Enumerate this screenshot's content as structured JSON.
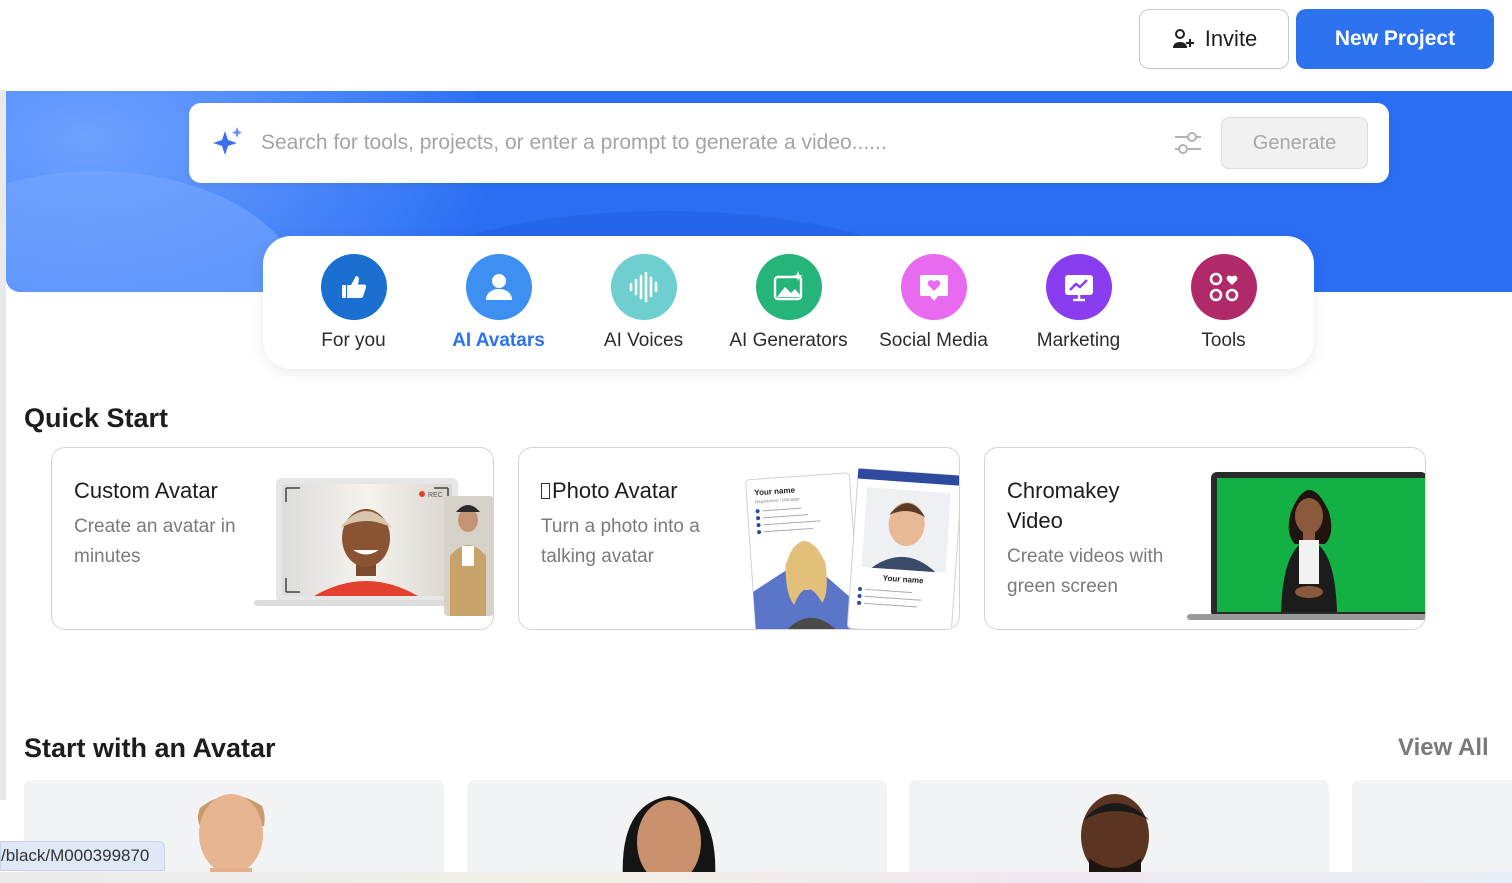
{
  "header": {
    "invite_label": "Invite",
    "new_project_label": "New Project"
  },
  "search": {
    "placeholder": "Search for tools, projects, or enter a prompt to generate a video......",
    "generate_label": "Generate"
  },
  "categories": [
    {
      "label": "For you",
      "icon": "thumbs-up-icon",
      "color": "#1a6fd0"
    },
    {
      "label": "AI Avatars",
      "icon": "user-icon",
      "color": "#3d8ff2",
      "active": true
    },
    {
      "label": "AI Voices",
      "icon": "sound-wave-icon",
      "color": "#6fcfcf"
    },
    {
      "label": "AI Generators",
      "icon": "image-sparkle-icon",
      "color": "#25b57a"
    },
    {
      "label": "Social Media",
      "icon": "heart-message-icon",
      "color": "#e86af0"
    },
    {
      "label": "Marketing",
      "icon": "chart-board-icon",
      "color": "#8a3df0"
    },
    {
      "label": "Tools",
      "icon": "grid-heart-icon",
      "color": "#b02a6a"
    }
  ],
  "quick_start": {
    "title": "Quick Start",
    "cards": [
      {
        "title": "Custom Avatar",
        "description": "Create an avatar in minutes"
      },
      {
        "title": "Photo Avatar",
        "title_prefix": "",
        "description": "Turn a photo into a talking avatar"
      },
      {
        "title": "Chromakey Video",
        "description": "Create videos with green screen"
      }
    ],
    "art_text": {
      "rec": "REC",
      "your_name": "Your name",
      "department": "Department / Manager"
    }
  },
  "avatars_section": {
    "title": "Start with an Avatar",
    "view_all_label": "View All"
  },
  "status_url": "/black/M000399870",
  "colors": {
    "primary": "#2d73f0",
    "hero": "#2b6ef3",
    "green_screen": "#13b043"
  }
}
